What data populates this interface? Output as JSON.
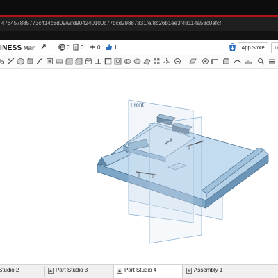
{
  "browser": {
    "url": "476457885773c414c8d09/w/d904240100c77dcd29887831/e/8b26b1ee3f48114a58c0afcf"
  },
  "document": {
    "title": "INESS",
    "branch": "Main",
    "globe_count": "0",
    "version_count": "0",
    "likes_count": "1",
    "app_store_label": "App Store",
    "learn_label": "Le"
  },
  "viewport": {
    "plane_label": "Front"
  },
  "tabs": [
    {
      "label": "Studio 2"
    },
    {
      "label": "Part Studio 3"
    },
    {
      "label": "Part Studio 4"
    },
    {
      "label": "Assembly 1"
    }
  ],
  "colors": {
    "accent_red": "#b4121b",
    "part_blue": "#a9c9e2",
    "plane_blue": "#cfe0f0"
  }
}
